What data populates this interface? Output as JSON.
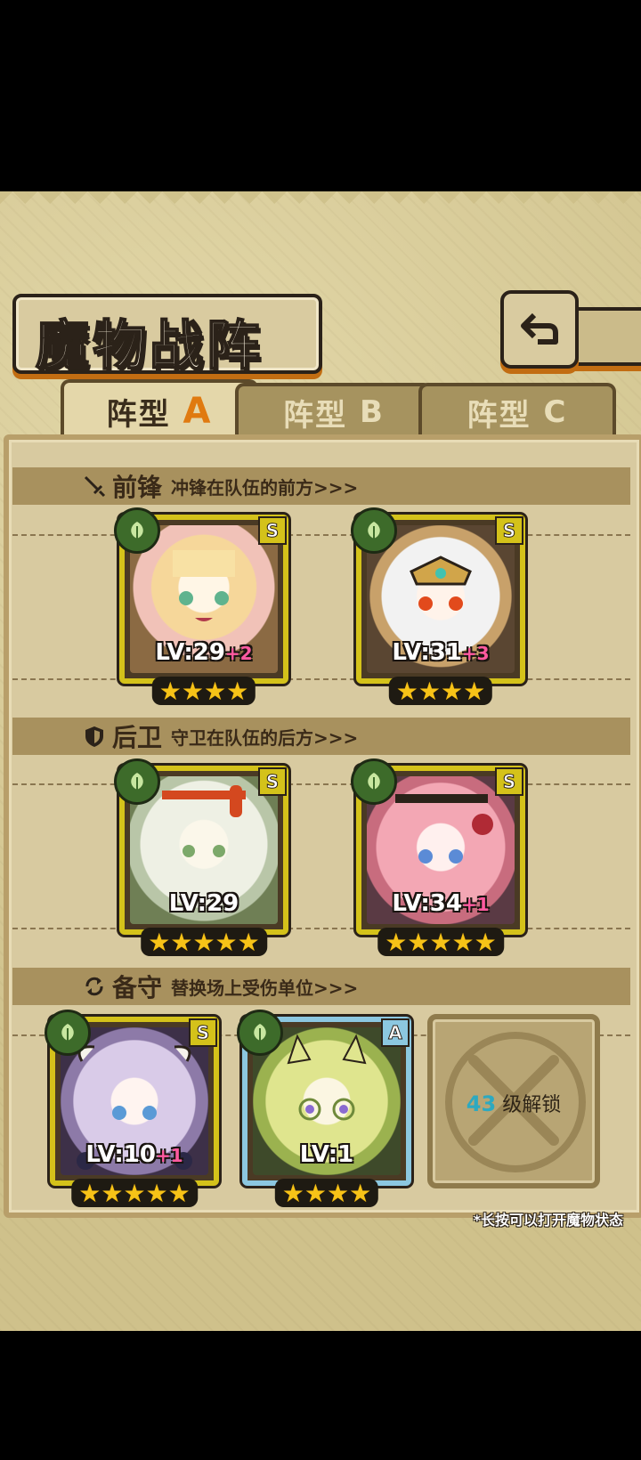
{
  "title": "魔物战阵",
  "tabs": [
    {
      "label": "阵型",
      "letter": "A"
    },
    {
      "label": "阵型",
      "letter": "B"
    },
    {
      "label": "阵型",
      "letter": "C"
    }
  ],
  "rows": {
    "vanguard": {
      "name": "前锋",
      "desc": "冲锋在队伍的前方>>>"
    },
    "rearguard": {
      "name": "后卫",
      "desc": "守卫在队伍的后方>>>"
    },
    "reserve": {
      "name": "备守",
      "desc": "替换场上受伤单位>>>"
    }
  },
  "cards": [
    {
      "rank": "S",
      "lv": "LV:29",
      "plus": "+2",
      "stars": "★★★★"
    },
    {
      "rank": "S",
      "lv": "LV:31",
      "plus": "+3",
      "stars": "★★★★"
    },
    {
      "rank": "S",
      "lv": "LV:29",
      "plus": "",
      "stars": "★★★★★"
    },
    {
      "rank": "S",
      "lv": "LV:34",
      "plus": "+1",
      "stars": "★★★★★"
    },
    {
      "rank": "S",
      "lv": "LV:10",
      "plus": "+1",
      "stars": "★★★★★"
    },
    {
      "rank": "A",
      "lv": "LV:1",
      "plus": "",
      "stars": "★★★★"
    }
  ],
  "locked_slot": {
    "level": "43",
    "text": "级解锁"
  },
  "hint": "*长按可以打开魔物状态",
  "colors": {
    "accent": "#e07a10",
    "rank_s": "#d4c21a",
    "rank_a": "#8cc7e0",
    "plus": "#ff5aa0"
  }
}
